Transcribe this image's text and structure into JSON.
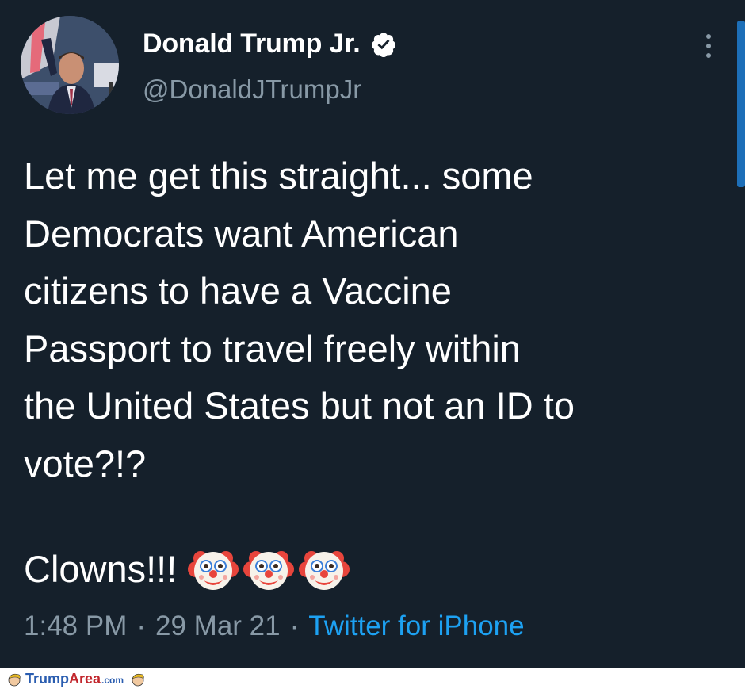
{
  "tweet": {
    "author": {
      "display_name": "Donald Trump Jr.",
      "handle": "@DonaldJTrumpJr",
      "verified_icon": "verified-badge-icon",
      "avatar_icon": "profile-photo"
    },
    "body": "Let me get this straight... some\nDemocrats want American\ncitizens to have a Vaccine\nPassport to travel freely within\nthe United States but not an ID to\nvote?!?",
    "closing": {
      "label": "Clowns!!!",
      "emoji_icon": "clown-face-icon",
      "emoji_count": 3
    },
    "meta": {
      "time": "1:48 PM",
      "separator": "·",
      "date": "29 Mar 21",
      "source": "Twitter for iPhone"
    },
    "more_icon": "more-vertical-icon"
  },
  "footer": {
    "brand_part1": "Trump",
    "brand_part2": "Area",
    "brand_part3": ".com"
  },
  "colors": {
    "background": "#15202b",
    "text": "#ffffff",
    "muted": "#8899a6",
    "link": "#1da1f2"
  }
}
